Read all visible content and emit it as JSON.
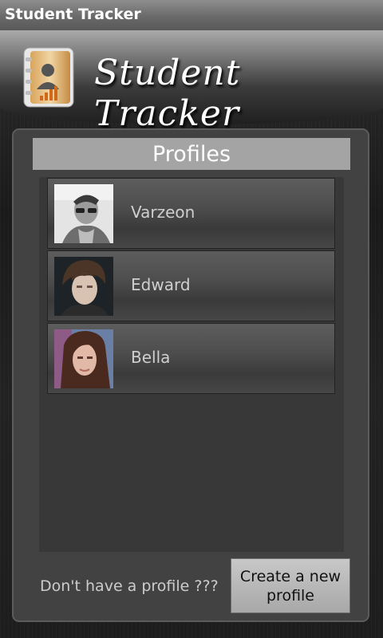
{
  "window": {
    "title": "Student Tracker"
  },
  "header": {
    "title": "Student Tracker",
    "icon": "contact-book-icon"
  },
  "profiles": {
    "heading": "Profiles",
    "items": [
      {
        "name": "Varzeon",
        "avatar": "avatar-varzeon"
      },
      {
        "name": "Edward",
        "avatar": "avatar-edward"
      },
      {
        "name": "Bella",
        "avatar": "avatar-bella"
      }
    ]
  },
  "footer": {
    "prompt": "Don't have a profile ???",
    "create_button": "Create a new profile"
  },
  "colors": {
    "panel": "#424242",
    "heading_bar": "#a4a4a4",
    "button": "#b8b8b8"
  }
}
